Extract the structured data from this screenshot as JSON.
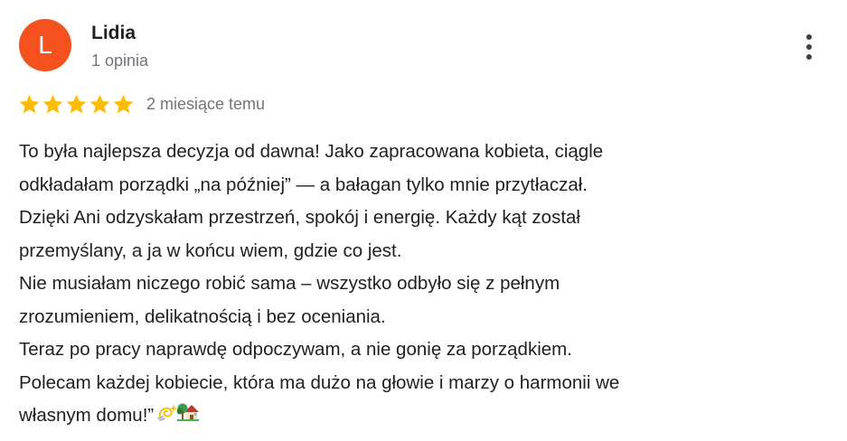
{
  "review": {
    "avatar_letter": "L",
    "avatar_color": "#f4511e",
    "author": "Lidia",
    "review_count": "1 opinia",
    "rating": 5,
    "rating_max": 5,
    "star_color": "#fbbc04",
    "date": "2 miesiące temu",
    "more_icon": "more-vert-icon",
    "lines": [
      "To była najlepsza decyzja od dawna! Jako zapracowana kobieta, ciągle",
      "odkładałam porządki „na później” — a bałagan tylko mnie przytłaczał.",
      "Dzięki Ani odzyskałam przestrzeń, spokój i energię. Każdy kąt został",
      "przemyślany, a ja w końcu wiem, gdzie co jest.",
      "Nie musiałam niczego robić sama – wszystko odbyło się z pełnym",
      "zrozumieniem, delikatnością i bez oceniania.",
      "Teraz po pracy naprawdę odpoczywam, a nie gonię za porządkiem.",
      "Polecam każdej kobiecie, która ma dużo na głowie i marzy o harmonii we",
      "własnym domu!”"
    ],
    "trailing_emojis": [
      "dizzy-emoji",
      "house-with-garden-emoji"
    ]
  }
}
